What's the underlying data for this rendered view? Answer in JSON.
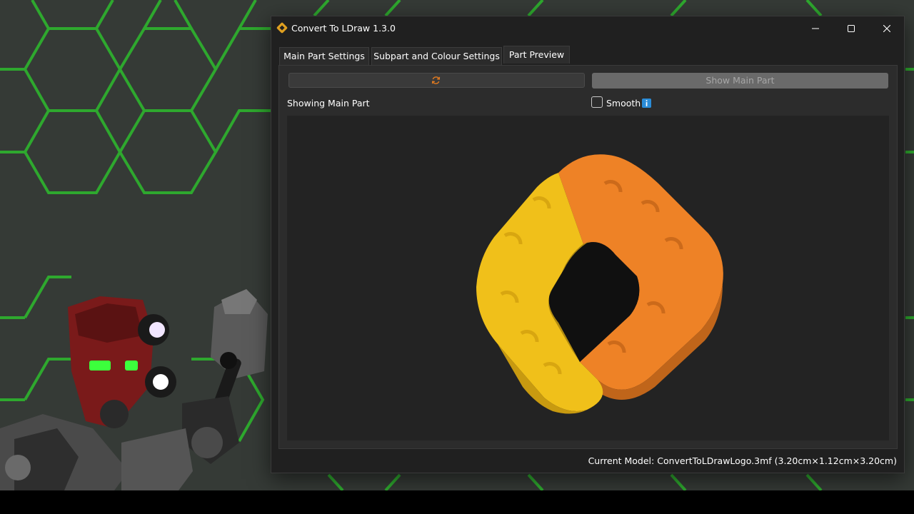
{
  "window": {
    "title": "Convert To LDraw 1.3.0",
    "accent": "#e0a020"
  },
  "tabs": [
    {
      "label": "Main Part Settings"
    },
    {
      "label": "Subpart and Colour Settings"
    },
    {
      "label": "Part Preview",
      "active": true
    }
  ],
  "preview": {
    "reload_icon": "refresh-icon",
    "show_button_label": "Show Main Part",
    "status_label": "Showing Main Part",
    "smooth_label": "Smooth",
    "smooth_checked": false,
    "info_icon": "info-icon",
    "model_colors": {
      "yellow": "#f0c01a",
      "orange": "#ee8226"
    }
  },
  "footer": {
    "model_info": "Current Model: ConvertToLDrawLogo.3mf (3.20cm×1.12cm×3.20cm)"
  }
}
